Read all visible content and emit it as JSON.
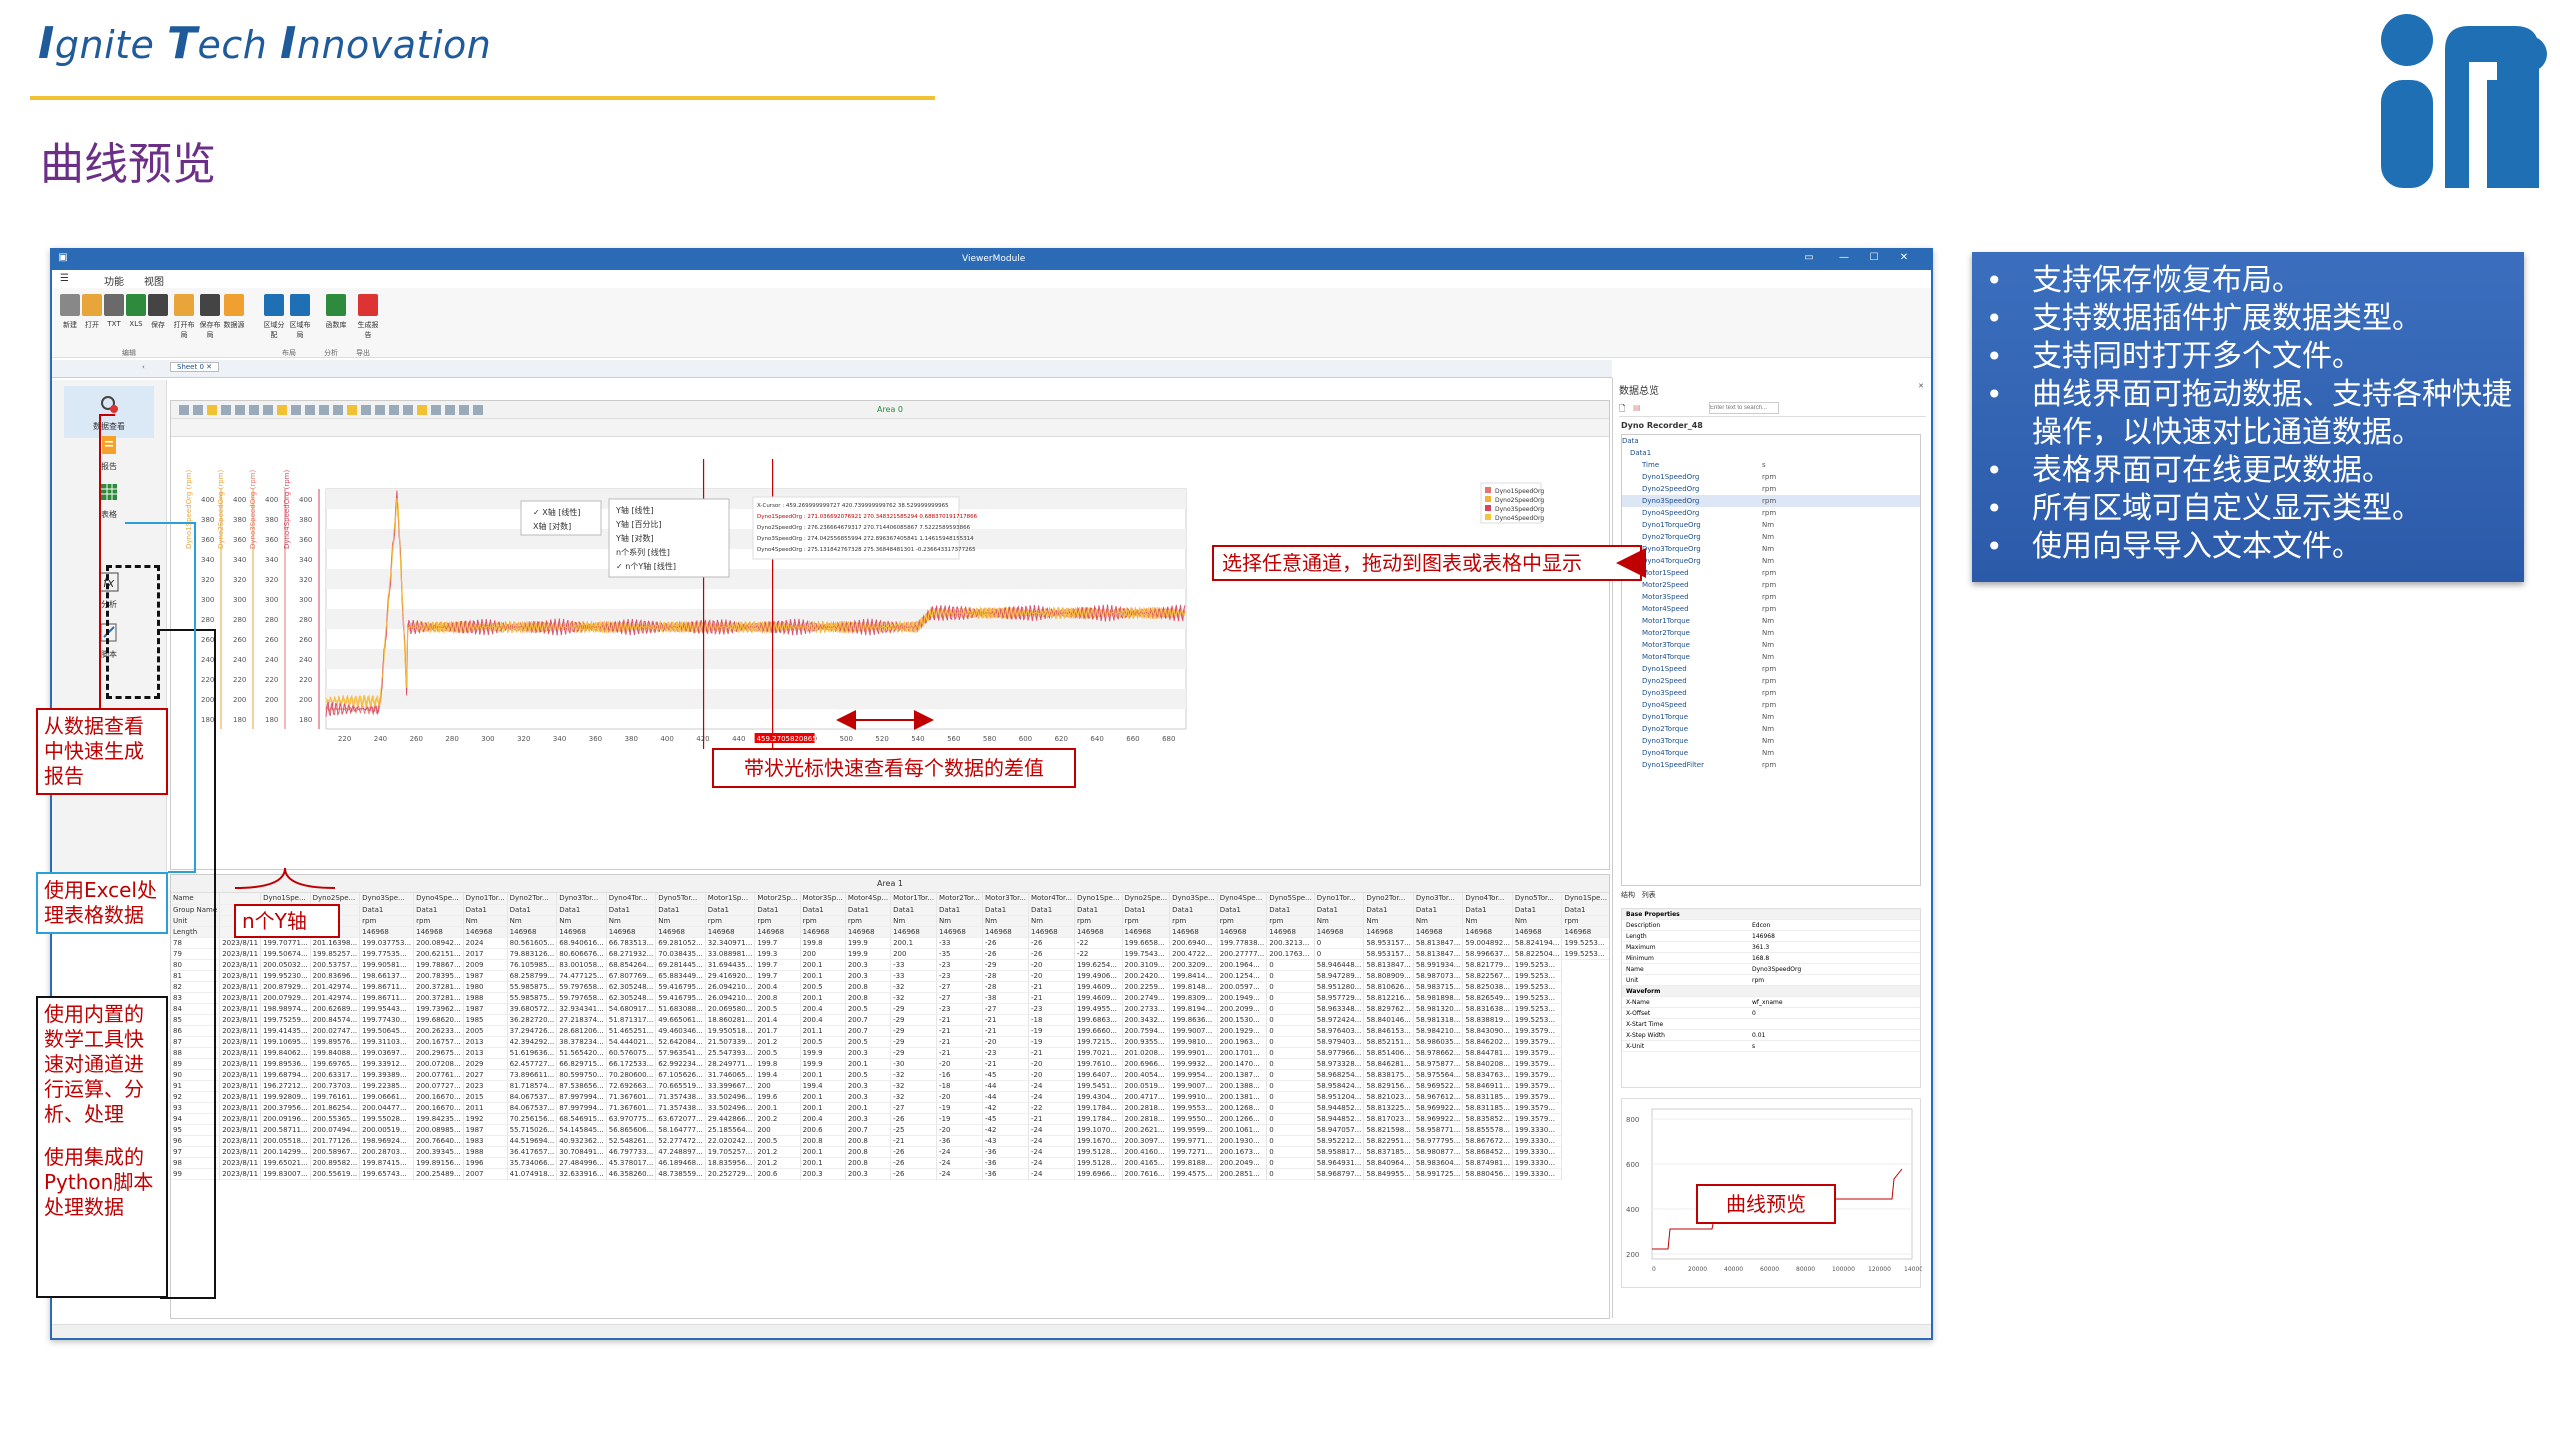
{
  "brand": {
    "word1_cap": "I",
    "word1_rest": "gnite",
    "word2_cap": "T",
    "word2_rest": "ech",
    "word3_cap": "I",
    "word3_rest": "nnovation"
  },
  "slide_title": "曲线预览",
  "bullets": [
    "支持保存恢复布局。",
    "支持数据插件扩展数据类型。",
    "支持同时打开多个文件。",
    "曲线界面可拖动数据、支持各种快捷操作，以快速对比通道数据。",
    "表格界面可在线更改数据。",
    "所有区域可自定义显示类型。",
    "使用向导导入文本文件。"
  ],
  "app": {
    "title": "ViewerModule",
    "menu": [
      "功能",
      "视图"
    ],
    "ribbon_buttons": [
      "新建",
      "打开",
      "TXT",
      "XLS",
      "保存",
      "打开布局",
      "保存布局",
      "数据源",
      "区域分配",
      "区域布局",
      "函数库",
      "生成报告"
    ],
    "ribbon_groups": [
      "编辑",
      "布局",
      "分析",
      "导出"
    ],
    "doc_tab": "Sheet 0",
    "left_nav": [
      "数据查看",
      "报告",
      "表格",
      "分析",
      "脚本"
    ],
    "chart_area_title": "Area 0",
    "table_area_title": "Area 1",
    "right_panel_title": "数据总览",
    "search_placeholder": "Enter text to search...",
    "tree_root": "Dyno Recorder_48",
    "tree_nodes": [
      "Data",
      "Data1",
      "Time",
      "Dyno1SpeedOrg",
      "Dyno2SpeedOrg",
      "Dyno3SpeedOrg",
      "Dyno4SpeedOrg",
      "Dyno1TorqueOrg",
      "Dyno2TorqueOrg",
      "Dyno3TorqueOrg",
      "Dyno4TorqueOrg",
      "Motor1Speed",
      "Motor2Speed",
      "Motor3Speed",
      "Motor4Speed",
      "Motor1Torque",
      "Motor2Torque",
      "Motor3Torque",
      "Motor4Torque",
      "Dyno1Speed",
      "Dyno2Speed",
      "Dyno3Speed",
      "Dyno4Speed",
      "Dyno1Torque",
      "Dyno2Torque",
      "Dyno3Torque",
      "Dyno4Torque",
      "Dyno1SpeedFilter"
    ],
    "tree_units": [
      "s",
      "rpm",
      "rpm",
      "rpm",
      "rpm",
      "Nm",
      "Nm",
      "Nm",
      "Nm",
      "rpm",
      "rpm",
      "rpm",
      "rpm",
      "Nm",
      "Nm",
      "Nm",
      "Nm",
      "rpm",
      "rpm",
      "rpm",
      "rpm",
      "Nm",
      "Nm",
      "Nm",
      "Nm",
      "rpm"
    ],
    "panel_tabs": [
      "结构",
      "列表"
    ],
    "properties": {
      "section1": "Base Properties",
      "section2": "Waveform",
      "rows": [
        [
          "Description",
          "Edcon"
        ],
        [
          "Length",
          "146968"
        ],
        [
          "Maximum",
          "361.3"
        ],
        [
          "Minimum",
          "168.8"
        ],
        [
          "Name",
          "Dyno3SpeedOrg"
        ],
        [
          "Unit",
          "rpm"
        ],
        [
          "X-Name",
          "wf_xname"
        ],
        [
          "X-Offset",
          "0"
        ],
        [
          "X-Start Time",
          ""
        ],
        [
          "X-Step Width",
          "0.01"
        ],
        [
          "X-Unit",
          "s"
        ]
      ]
    },
    "preview_label": "曲线预览",
    "preview_x_ticks": [
      "0",
      "20000",
      "40000",
      "60000",
      "80000",
      "100000",
      "120000",
      "140000"
    ],
    "preview_y_ticks": [
      "800",
      "600",
      "400",
      "200"
    ],
    "legend": [
      "Dyno1SpeedOrg",
      "Dyno2SpeedOrg",
      "Dyno3SpeedOrg",
      "Dyno4SpeedOrg"
    ],
    "axis_menu_left": [
      "X轴 [线性]",
      "X轴 [对数]"
    ],
    "axis_menu_right": [
      "Y轴 [线性]",
      "Y轴 [百分比]",
      "Y轴 [对数]",
      "n个系列 [线性]",
      "n个Y轴 [线性]"
    ],
    "cursor_info": [
      "X-Cursor : 459.269999999727   420.739999999762   38.529999999965",
      "Dyno1SpeedOrg : 271.036692076921   270.348321585294   0.688370191717866",
      "Dyno2SpeedOrg : 276.236664679317   270.714406085867   7.5222589593866",
      "Dyno3SpeedOrg : 274.042556855994   272.896367405841   1.14615948155314",
      "Dyno4SpeedOrg : 275.131842767328   275.36848481301   -0.236643317377265"
    ],
    "cursor_value": "459.270582086551",
    "x_ticks": [
      "220",
      "240",
      "260",
      "280",
      "300",
      "320",
      "340",
      "360",
      "380",
      "400",
      "420",
      "440",
      "460",
      "480",
      "500",
      "520",
      "540",
      "560",
      "580",
      "600",
      "620",
      "640",
      "660",
      "680"
    ],
    "y_ticks": [
      "400",
      "380",
      "360",
      "340",
      "320",
      "300",
      "280",
      "260",
      "240",
      "220",
      "200",
      "180"
    ],
    "y_axis_names": [
      "Dyno1SpeedOrg (rpm)",
      "Dyno2SpeedOrg (rpm)",
      "Dyno3SpeedOrg (rpm)",
      "Dyno4SpeedOrg (rpm)"
    ],
    "table_row_headers": [
      "Name",
      "Group Name",
      "Unit",
      "Length"
    ],
    "table_columns": [
      "Dyno1Spe...",
      "Dyno2Spe...",
      "Dyno3Spe...",
      "Dyno4Spe...",
      "Dyno1Tor...",
      "Dyno2Tor...",
      "Dyno3Tor...",
      "Dyno4Tor...",
      "Dyno5Tor...",
      "Motor1Sp...",
      "Motor2Sp...",
      "Motor3Sp...",
      "Motor4Sp...",
      "Motor1Tor...",
      "Motor2Tor...",
      "Motor3Tor...",
      "Motor4Tor...",
      "Dyno1Spe...",
      "Dyno2Spe...",
      "Dyno3Spe...",
      "Dyno4Spe...",
      "Dyno5Spe...",
      "Dyno1Tor...",
      "Dyno2Tor...",
      "Dyno3Tor...",
      "Dyno4Tor...",
      "Dyno5Tor...",
      "Dyno1Spe..."
    ],
    "table_group": "Data1",
    "table_length": "146968",
    "table_units": [
      "rpm",
      "rpm",
      "rpm",
      "rpm",
      "Nm",
      "Nm",
      "Nm",
      "Nm",
      "Nm",
      "rpm",
      "rpm",
      "rpm",
      "rpm",
      "Nm",
      "Nm",
      "Nm",
      "Nm",
      "rpm",
      "rpm",
      "rpm",
      "rpm",
      "rpm",
      "Nm",
      "Nm",
      "Nm",
      "Nm",
      "Nm",
      "rpm"
    ],
    "table_rows": [
      [
        "78",
        "2023/8/11",
        "199.70771...",
        "201.16398...",
        "199.037753...",
        "200.08942...",
        "2024",
        "80.561605...",
        "68.940616...",
        "66.783513...",
        "69.281052...",
        "32.340971...",
        "199.7",
        "199.8",
        "199.9",
        "200.1",
        "-33",
        "-26",
        "-26",
        "-22",
        "199.6658...",
        "200.6940...",
        "199.77838...",
        "200.3213...",
        "0",
        "58.953157...",
        "58.813847...",
        "59.004892...",
        "58.824194...",
        "199.5253..."
      ],
      [
        "79",
        "2023/8/11",
        "199.50674...",
        "199.85257...",
        "199.77535...",
        "200.62151...",
        "2017",
        "79.883126...",
        "80.606676...",
        "68.271932...",
        "70.038435...",
        "33.088981...",
        "199.3",
        "200",
        "199.9",
        "200",
        "-35",
        "-26",
        "-26",
        "-22",
        "199.7543...",
        "200.4722...",
        "200.27777...",
        "200.1763...",
        "0",
        "58.953157...",
        "58.813847...",
        "58.996637...",
        "58.822504...",
        "199.5253..."
      ],
      [
        "80",
        "2023/8/11",
        "200.05032...",
        "200.53757...",
        "199.90581...",
        "199.78867...",
        "2009",
        "76.105985...",
        "83.001058...",
        "68.854264...",
        "69.281445...",
        "31.694435...",
        "199.7",
        "200.1",
        "200.3",
        "-33",
        "-23",
        "-29",
        "-20",
        "199.6254...",
        "200.3109...",
        "200.3209...",
        "200.1964...",
        "0",
        "58.946448...",
        "58.813847...",
        "58.991934...",
        "58.821779...",
        "199.5253..."
      ],
      [
        "81",
        "2023/8/11",
        "199.95230...",
        "200.83696...",
        "198.66137...",
        "200.78395...",
        "1987",
        "68.258799...",
        "74.477125...",
        "67.807769...",
        "65.883449...",
        "29.416920...",
        "199.7",
        "200.1",
        "200.3",
        "-33",
        "-23",
        "-28",
        "-20",
        "199.4906...",
        "200.2420...",
        "199.8414...",
        "200.1254...",
        "0",
        "58.947289...",
        "58.808909...",
        "58.987073...",
        "58.822567...",
        "199.5253..."
      ],
      [
        "82",
        "2023/8/11",
        "200.87929...",
        "201.42974...",
        "199.86711...",
        "200.37281...",
        "1980",
        "55.985875...",
        "59.797658...",
        "62.305248...",
        "59.416795...",
        "26.094210...",
        "200.4",
        "200.5",
        "200.8",
        "-32",
        "-27",
        "-28",
        "-21",
        "199.4609...",
        "200.2259...",
        "199.8148...",
        "200.0597...",
        "0",
        "58.951280...",
        "58.810626...",
        "58.983715...",
        "58.825038...",
        "199.5253..."
      ],
      [
        "83",
        "2023/8/11",
        "200.07929...",
        "201.42974...",
        "199.86711...",
        "200.37281...",
        "1988",
        "55.985875...",
        "59.797658...",
        "62.305248...",
        "59.416795...",
        "26.094210...",
        "200.8",
        "200.1",
        "200.8",
        "-32",
        "-27",
        "-38",
        "-21",
        "199.4609...",
        "200.2749...",
        "199.8309...",
        "200.1949...",
        "0",
        "58.957729...",
        "58.812216...",
        "58.981898...",
        "58.826549...",
        "199.5253..."
      ],
      [
        "84",
        "2023/8/11",
        "198.98974...",
        "200.62689...",
        "199.95443...",
        "199.73962...",
        "1987",
        "39.680572...",
        "32.934341...",
        "54.680917...",
        "51.683088...",
        "20.069580...",
        "200.5",
        "200.4",
        "200.5",
        "-29",
        "-23",
        "-27",
        "-23",
        "199.4955...",
        "200.2733...",
        "199.8194...",
        "200.2099...",
        "0",
        "58.963348...",
        "58.829762...",
        "58.981320...",
        "58.831638...",
        "199.5253..."
      ],
      [
        "85",
        "2023/8/11",
        "199.75259...",
        "200.84574...",
        "199.77430...",
        "199.68620...",
        "1985",
        "36.282720...",
        "27.218374...",
        "51.871317...",
        "49.665061...",
        "18.860281...",
        "201.4",
        "200.4",
        "200.7",
        "-29",
        "-21",
        "-21",
        "-18",
        "199.6863...",
        "200.3432...",
        "199.8636...",
        "200.1530...",
        "0",
        "58.972424...",
        "58.840146...",
        "58.981318...",
        "58.838819...",
        "199.5253..."
      ],
      [
        "86",
        "2023/8/11",
        "199.41435...",
        "200.02747...",
        "199.50645...",
        "200.26233...",
        "2005",
        "37.294726...",
        "28.681206...",
        "51.465251...",
        "49.460346...",
        "19.950518...",
        "201.7",
        "201.1",
        "200.7",
        "-29",
        "-21",
        "-21",
        "-19",
        "199.6660...",
        "200.7594...",
        "199.9007...",
        "200.1929...",
        "0",
        "58.976403...",
        "58.846153...",
        "58.984210...",
        "58.843090...",
        "199.3579..."
      ],
      [
        "87",
        "2023/8/11",
        "199.10695...",
        "199.89576...",
        "199.31103...",
        "200.16757...",
        "2013",
        "42.394292...",
        "38.378234...",
        "54.444021...",
        "52.642084...",
        "21.507339...",
        "201.2",
        "200.5",
        "200.5",
        "-29",
        "-21",
        "-20",
        "-19",
        "199.7215...",
        "200.9355...",
        "199.9810...",
        "200.1963...",
        "0",
        "58.979403...",
        "58.852151...",
        "58.986035...",
        "58.846202...",
        "199.3579..."
      ],
      [
        "88",
        "2023/8/11",
        "199.84062...",
        "199.84088...",
        "199.03697...",
        "200.29675...",
        "2013",
        "51.619636...",
        "51.565420...",
        "60.576075...",
        "57.963541...",
        "25.547393...",
        "200.5",
        "199.9",
        "200.3",
        "-29",
        "-21",
        "-23",
        "-21",
        "199.7021...",
        "201.0208...",
        "199.9901...",
        "200.1701...",
        "0",
        "58.977966...",
        "58.851406...",
        "58.978662...",
        "58.844781...",
        "199.3579..."
      ],
      [
        "89",
        "2023/8/11",
        "199.89536...",
        "199.69765...",
        "199.33912...",
        "200.07208...",
        "2029",
        "62.457727...",
        "66.829715...",
        "66.172533...",
        "62.992234...",
        "28.249771...",
        "199.8",
        "199.9",
        "200.1",
        "-30",
        "-20",
        "-21",
        "-20",
        "199.7610...",
        "200.6966...",
        "199.9932...",
        "200.1470...",
        "0",
        "58.973328...",
        "58.846281...",
        "58.975877...",
        "58.840208...",
        "199.3579..."
      ],
      [
        "90",
        "2023/8/11",
        "199.68794...",
        "200.63317...",
        "199.39389...",
        "200.07761...",
        "2027",
        "73.896611...",
        "80.599750...",
        "70.280600...",
        "67.105626...",
        "31.746065...",
        "199.4",
        "200.1",
        "200.5",
        "-32",
        "-16",
        "-45",
        "-20",
        "199.6407...",
        "200.4054...",
        "199.9954...",
        "200.1387...",
        "0",
        "58.968254...",
        "58.838175...",
        "58.975564...",
        "58.834763...",
        "199.3579..."
      ],
      [
        "91",
        "2023/8/11",
        "196.27212...",
        "200.73703...",
        "199.22385...",
        "200.07727...",
        "2023",
        "81.718574...",
        "87.538656...",
        "72.692663...",
        "70.665519...",
        "33.399667...",
        "200",
        "199.4",
        "200.3",
        "-32",
        "-18",
        "-44",
        "-24",
        "199.5451...",
        "200.0519...",
        "199.9007...",
        "200.1388...",
        "0",
        "58.958424...",
        "58.829156...",
        "58.969522...",
        "58.846911...",
        "199.3579..."
      ],
      [
        "92",
        "2023/8/11",
        "199.92809...",
        "199.76161...",
        "199.06661...",
        "200.16670...",
        "2015",
        "84.067537...",
        "87.997994...",
        "71.367601...",
        "71.357438...",
        "33.502496...",
        "199.6",
        "200.1",
        "200.3",
        "-32",
        "-20",
        "-44",
        "-24",
        "199.4304...",
        "200.4717...",
        "199.9910...",
        "200.1381...",
        "0",
        "58.951204...",
        "58.821023...",
        "58.967612...",
        "58.831185...",
        "199.3579..."
      ],
      [
        "93",
        "2023/8/11",
        "200.37956...",
        "201.86254...",
        "200.04477...",
        "200.16670...",
        "2011",
        "84.067537...",
        "87.997994...",
        "71.367601...",
        "71.357438...",
        "33.502496...",
        "200.1",
        "200.1",
        "200.1",
        "-27",
        "-19",
        "-42",
        "-22",
        "199.1784...",
        "200.2818...",
        "199.9553...",
        "200.1268...",
        "0",
        "58.944852...",
        "58.813225...",
        "58.969922...",
        "58.831185...",
        "199.3579..."
      ],
      [
        "94",
        "2023/8/11",
        "200.09196...",
        "200.55365...",
        "199.55028...",
        "199.84235...",
        "1992",
        "70.256156...",
        "68.546915...",
        "63.970775...",
        "63.672077...",
        "29.442866...",
        "200.2",
        "200.4",
        "200.3",
        "-26",
        "-19",
        "-45",
        "-21",
        "199.1784...",
        "200.2818...",
        "199.9550...",
        "200.1266...",
        "0",
        "58.944852...",
        "58.817023...",
        "58.969922...",
        "58.835852...",
        "199.3579..."
      ],
      [
        "95",
        "2023/8/11",
        "200.58711...",
        "200.07494...",
        "200.00519...",
        "200.08985...",
        "1987",
        "55.715026...",
        "54.145845...",
        "56.865606...",
        "58.164777...",
        "25.185564...",
        "200",
        "200.6",
        "200.7",
        "-25",
        "-20",
        "-42",
        "-24",
        "199.1070...",
        "200.2621...",
        "199.9599...",
        "200.1061...",
        "0",
        "58.947057...",
        "58.821598...",
        "58.958771...",
        "58.855578...",
        "199.3330..."
      ],
      [
        "96",
        "2023/8/11",
        "200.05518...",
        "201.77126...",
        "198.96924...",
        "200.76640...",
        "1983",
        "44.519694...",
        "40.932362...",
        "52.548261...",
        "52.277472...",
        "22.020242...",
        "200.5",
        "200.8",
        "200.8",
        "-21",
        "-36",
        "-43",
        "-24",
        "199.1670...",
        "200.3097...",
        "199.9771...",
        "200.1930...",
        "0",
        "58.952212...",
        "58.822951...",
        "58.977795...",
        "58.867672...",
        "199.3330..."
      ],
      [
        "97",
        "2023/8/11",
        "200.14299...",
        "200.58967...",
        "200.28703...",
        "200.39345...",
        "1988",
        "36.417657...",
        "30.708491...",
        "46.797733...",
        "47.248897...",
        "19.705257...",
        "201.2",
        "200.1",
        "200.8",
        "-26",
        "-24",
        "-36",
        "-24",
        "199.5128...",
        "200.4160...",
        "199.7271...",
        "200.1673...",
        "0",
        "58.958817...",
        "58.837185...",
        "58.980877...",
        "58.868452...",
        "199.3330..."
      ],
      [
        "98",
        "2023/8/11",
        "199.65021...",
        "200.89582...",
        "199.87415...",
        "199.89156...",
        "1996",
        "35.734066...",
        "27.484996...",
        "45.378017...",
        "46.189468...",
        "18.835956...",
        "201.2",
        "200.1",
        "200.8",
        "-26",
        "-24",
        "-36",
        "-24",
        "199.5128...",
        "200.4165...",
        "199.8188...",
        "200.2049...",
        "0",
        "58.964931...",
        "58.840964...",
        "58.983604...",
        "58.874981...",
        "199.3330..."
      ],
      [
        "99",
        "2023/8/11",
        "199.83007...",
        "200.55619...",
        "199.65743...",
        "200.25489...",
        "2007",
        "41.074918...",
        "32.633916...",
        "46.358260...",
        "48.738559...",
        "20.252729...",
        "200.6",
        "200.3",
        "200.3",
        "-26",
        "-24",
        "-36",
        "-24",
        "199.6966...",
        "200.7616...",
        "199.4575...",
        "200.2851...",
        "0",
        "58.968797...",
        "58.849955...",
        "58.991725...",
        "58.880456...",
        "199.3330..."
      ]
    ]
  },
  "annotations": {
    "drag_hint": "选择任意通道，拖动到图表或表格中显示",
    "cursor_hint": "带状光标快速查看每个数据的差值",
    "report_hint": "从数据查看中快速生成报告",
    "excel_hint": "使用Excel处理表格数据",
    "n_axis": "n个Y轴",
    "math_hint": "使用内置的数学工具快速对通道进行运算、分析、处理",
    "python_hint": "使用集成的Python脚本处理数据"
  },
  "colors": {
    "brand_blue": "#1f5b9a",
    "accent_yellow": "#f2c033",
    "title_purple": "#6b2f87",
    "bullet_bg": "#3b6fbe",
    "annot_red": "#c00000",
    "series1": "#e8736d",
    "series2": "#f2b33a",
    "series3": "#d64560",
    "series4": "#f7c43b"
  }
}
